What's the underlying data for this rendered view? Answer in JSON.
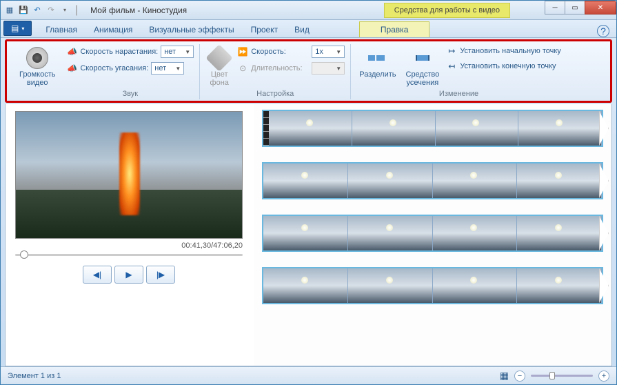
{
  "title": {
    "project": "Мой фильм",
    "app": "Киностудия"
  },
  "context_tab_group": "Средства для работы с видео",
  "tabs": {
    "home": "Главная",
    "animation": "Анимация",
    "effects": "Визуальные эффекты",
    "project": "Проект",
    "view": "Вид",
    "edit": "Правка"
  },
  "ribbon": {
    "volume": {
      "label": "Громкость\nвидео"
    },
    "sound": {
      "fadein_label": "Скорость нарастания:",
      "fadein_value": "нет",
      "fadeout_label": "Скорость угасания:",
      "fadeout_value": "нет",
      "group": "Звук"
    },
    "adjust": {
      "bgcolor": "Цвет\nфона",
      "speed_label": "Скорость:",
      "speed_value": "1x",
      "duration_label": "Длительность:",
      "duration_value": "",
      "group": "Настройка"
    },
    "edit": {
      "split": "Разделить",
      "trim": "Средство\nусечения",
      "set_start": "Установить начальную точку",
      "set_end": "Установить конечную точку",
      "group": "Изменение"
    }
  },
  "preview": {
    "time": "00:41,30/47:06,20"
  },
  "status": {
    "element": "Элемент 1 из 1"
  }
}
